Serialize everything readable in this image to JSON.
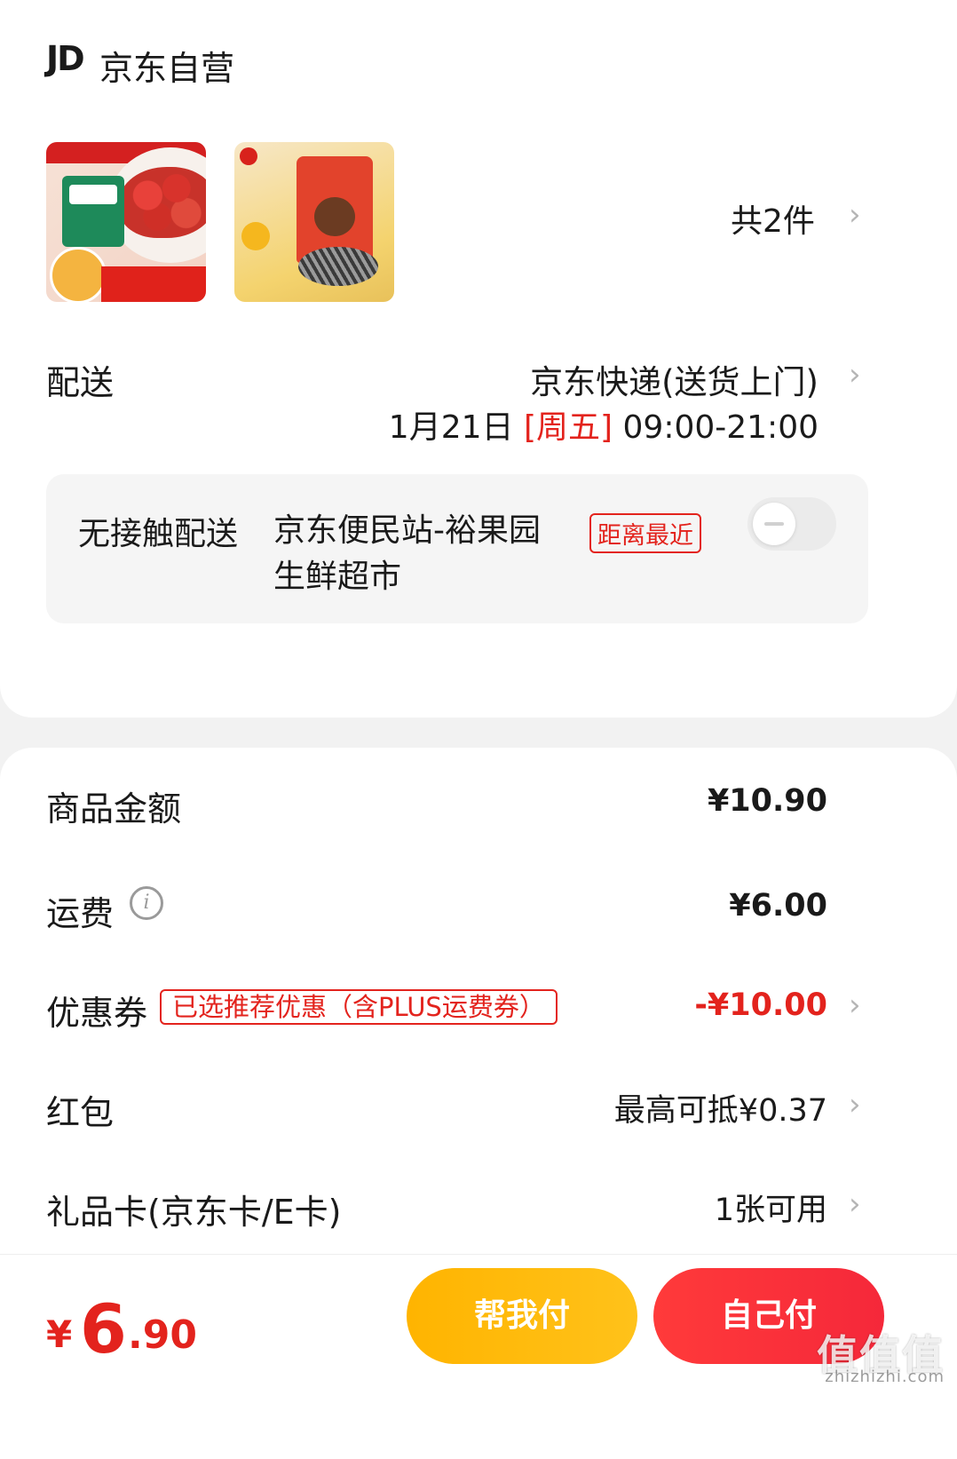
{
  "shop": {
    "logo_text": "JD",
    "name": "京东自营"
  },
  "products": {
    "count_text": "共2件"
  },
  "delivery": {
    "label": "配送",
    "method": "京东快递(送货上门)",
    "date": "1月21日",
    "weekday": "[周五]",
    "time_window": "09:00-21:00"
  },
  "contactless": {
    "label": "无接触配送",
    "station": "京东便民站-裕果园生鲜超市",
    "badge": "距离最近",
    "toggle_on": false
  },
  "summary": {
    "goods_label": "商品金额",
    "goods_value": "¥10.90",
    "shipping_label": "运费",
    "shipping_value": "¥6.00",
    "coupon_label": "优惠券",
    "coupon_badge": "已选推荐优惠（含PLUS运费券）",
    "coupon_value": "-¥10.00",
    "redpacket_label": "红包",
    "redpacket_value": "最高可抵¥0.37",
    "giftcard_label": "礼品卡(京东卡/E卡)",
    "giftcard_value": "1张可用"
  },
  "footer": {
    "currency": "¥",
    "total_int": "6",
    "total_dec": ".90",
    "help_pay": "帮我付",
    "self_pay": "自己付",
    "watermark": "值值值",
    "watermark_url": "zhizhizhi.com"
  },
  "colors": {
    "accent_red": "#e3231d",
    "help_yellow": "#ffb400",
    "pay_red": "#f5283a"
  },
  "icons": [
    "chevron-right-icon",
    "info-icon",
    "toggle-switch"
  ]
}
